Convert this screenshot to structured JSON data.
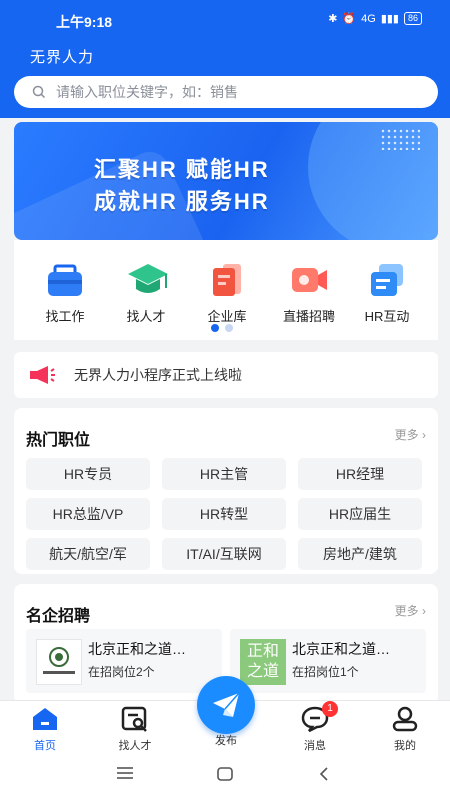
{
  "status": {
    "time": "上午9:18",
    "battery": "86",
    "network": "4G"
  },
  "app": {
    "name": "无界人力"
  },
  "search": {
    "placeholder": "请输入职位关键字，如：销售"
  },
  "banner": {
    "line1": "汇聚HR 赋能HR",
    "line2": "成就HR 服务HR"
  },
  "categories": [
    {
      "label": "找工作",
      "icon": "briefcase-icon"
    },
    {
      "label": "找人才",
      "icon": "graduation-cap-icon"
    },
    {
      "label": "企业库",
      "icon": "company-library-icon"
    },
    {
      "label": "直播招聘",
      "icon": "video-camera-icon"
    },
    {
      "label": "HR互动",
      "icon": "chat-cards-icon"
    }
  ],
  "notice": {
    "text": "无界人力小程序正式上线啦",
    "icon": "megaphone-icon"
  },
  "hot_jobs": {
    "title": "热门职位",
    "more": "更多",
    "tags": [
      "HR专员",
      "HR主管",
      "HR经理",
      "HR总监/VP",
      "HR转型",
      "HR应届生",
      "航天/航空/军",
      "IT/AI/互联网",
      "房地产/建筑"
    ]
  },
  "famous": {
    "title": "名企招聘",
    "more": "更多",
    "companies": [
      {
        "name": "北京正和之道…",
        "count": "在招岗位2个",
        "logo_text": "正和之道"
      },
      {
        "name": "北京正和之道…",
        "count": "在招岗位1个",
        "logo_text": "正和之道"
      }
    ]
  },
  "tabbar": {
    "home": "首页",
    "talent": "找人才",
    "publish": "发布",
    "messages": "消息",
    "messages_badge": "1",
    "mine": "我的"
  },
  "colors": {
    "primary": "#1766f1",
    "badge": "#ff3333"
  }
}
